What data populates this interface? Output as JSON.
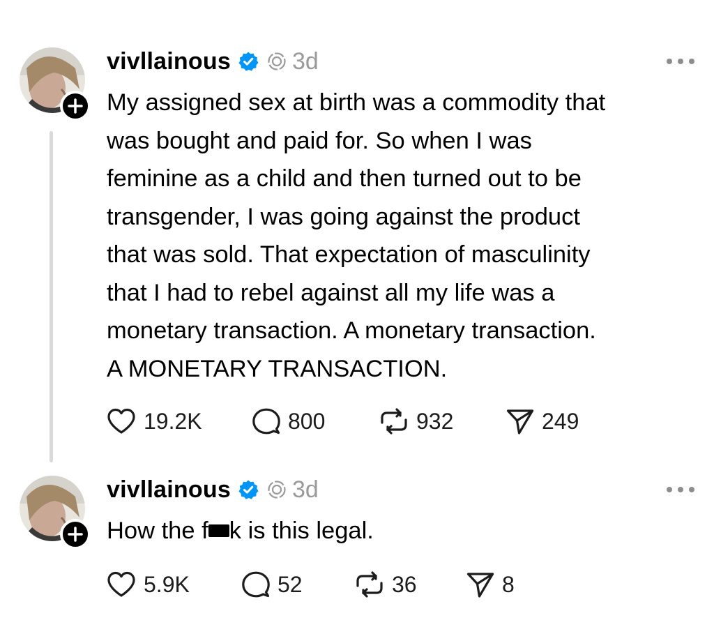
{
  "posts": [
    {
      "username": "vivllainous",
      "time": "3d",
      "text_lines": [
        "My assigned sex at birth was a commodity that",
        "was bought and paid for. So when I was",
        "feminine as a child and then turned out to be",
        "transgender, I was going against the product",
        "that was sold. That expectation of masculinity",
        "that I had to rebel against all my life was a",
        "monetary transaction. A monetary transaction.",
        "A MONETARY TRANSACTION."
      ],
      "likes": "19.2K",
      "replies": "800",
      "reposts": "932",
      "shares": "249"
    },
    {
      "username": "vivllainous",
      "time": "3d",
      "text_before": "How the f",
      "text_after": "k is this legal.",
      "likes": "5.9K",
      "replies": "52",
      "reposts": "36",
      "shares": "8"
    }
  ],
  "colors": {
    "verified": "#0095f6",
    "muted": "#9a9a9a",
    "thread_line": "#d9d9d9"
  },
  "icons": [
    "heart-icon",
    "comment-icon",
    "repost-icon",
    "share-icon",
    "verified-badge-icon",
    "ai-label-icon",
    "more-icon",
    "follow-plus-icon"
  ]
}
